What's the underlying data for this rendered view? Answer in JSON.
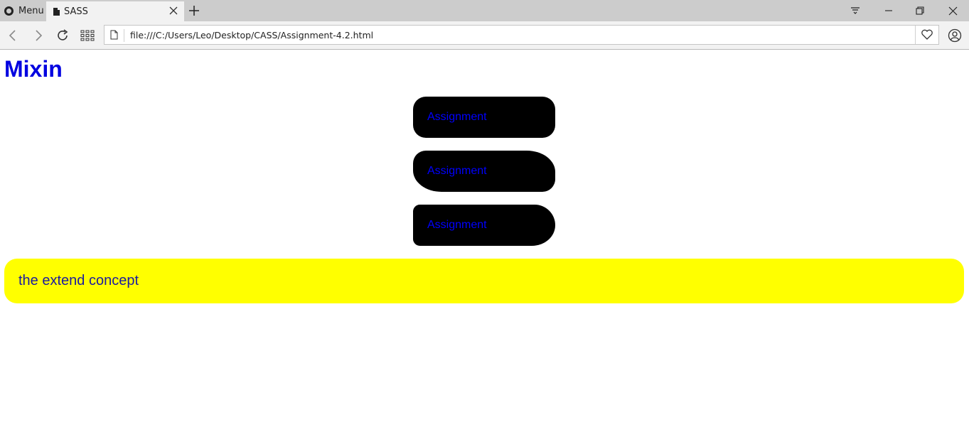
{
  "browser": {
    "menu_label": "Menu",
    "tab_title": "SASS",
    "url": "file:///C:/Users/Leo/Desktop/CASS/Assignment-4.2.html",
    "icons": [
      "opera-logo-icon",
      "document-icon",
      "close-icon",
      "plus-icon",
      "tab-menu-icon",
      "minimize-icon",
      "restore-icon",
      "close-window-icon",
      "back-icon",
      "forward-icon",
      "reload-icon",
      "speed-dial-icon",
      "page-icon",
      "heart-icon",
      "account-icon"
    ]
  },
  "page": {
    "title": "Mixin",
    "buttons": [
      {
        "label": "Assignment"
      },
      {
        "label": "Assignment"
      },
      {
        "label": "Assignment"
      }
    ],
    "extend_text": "the extend concept"
  },
  "colors": {
    "title": "#0000e0",
    "button_bg": "#000000",
    "button_text": "#0000ff",
    "extend_bg": "#ffff00"
  }
}
